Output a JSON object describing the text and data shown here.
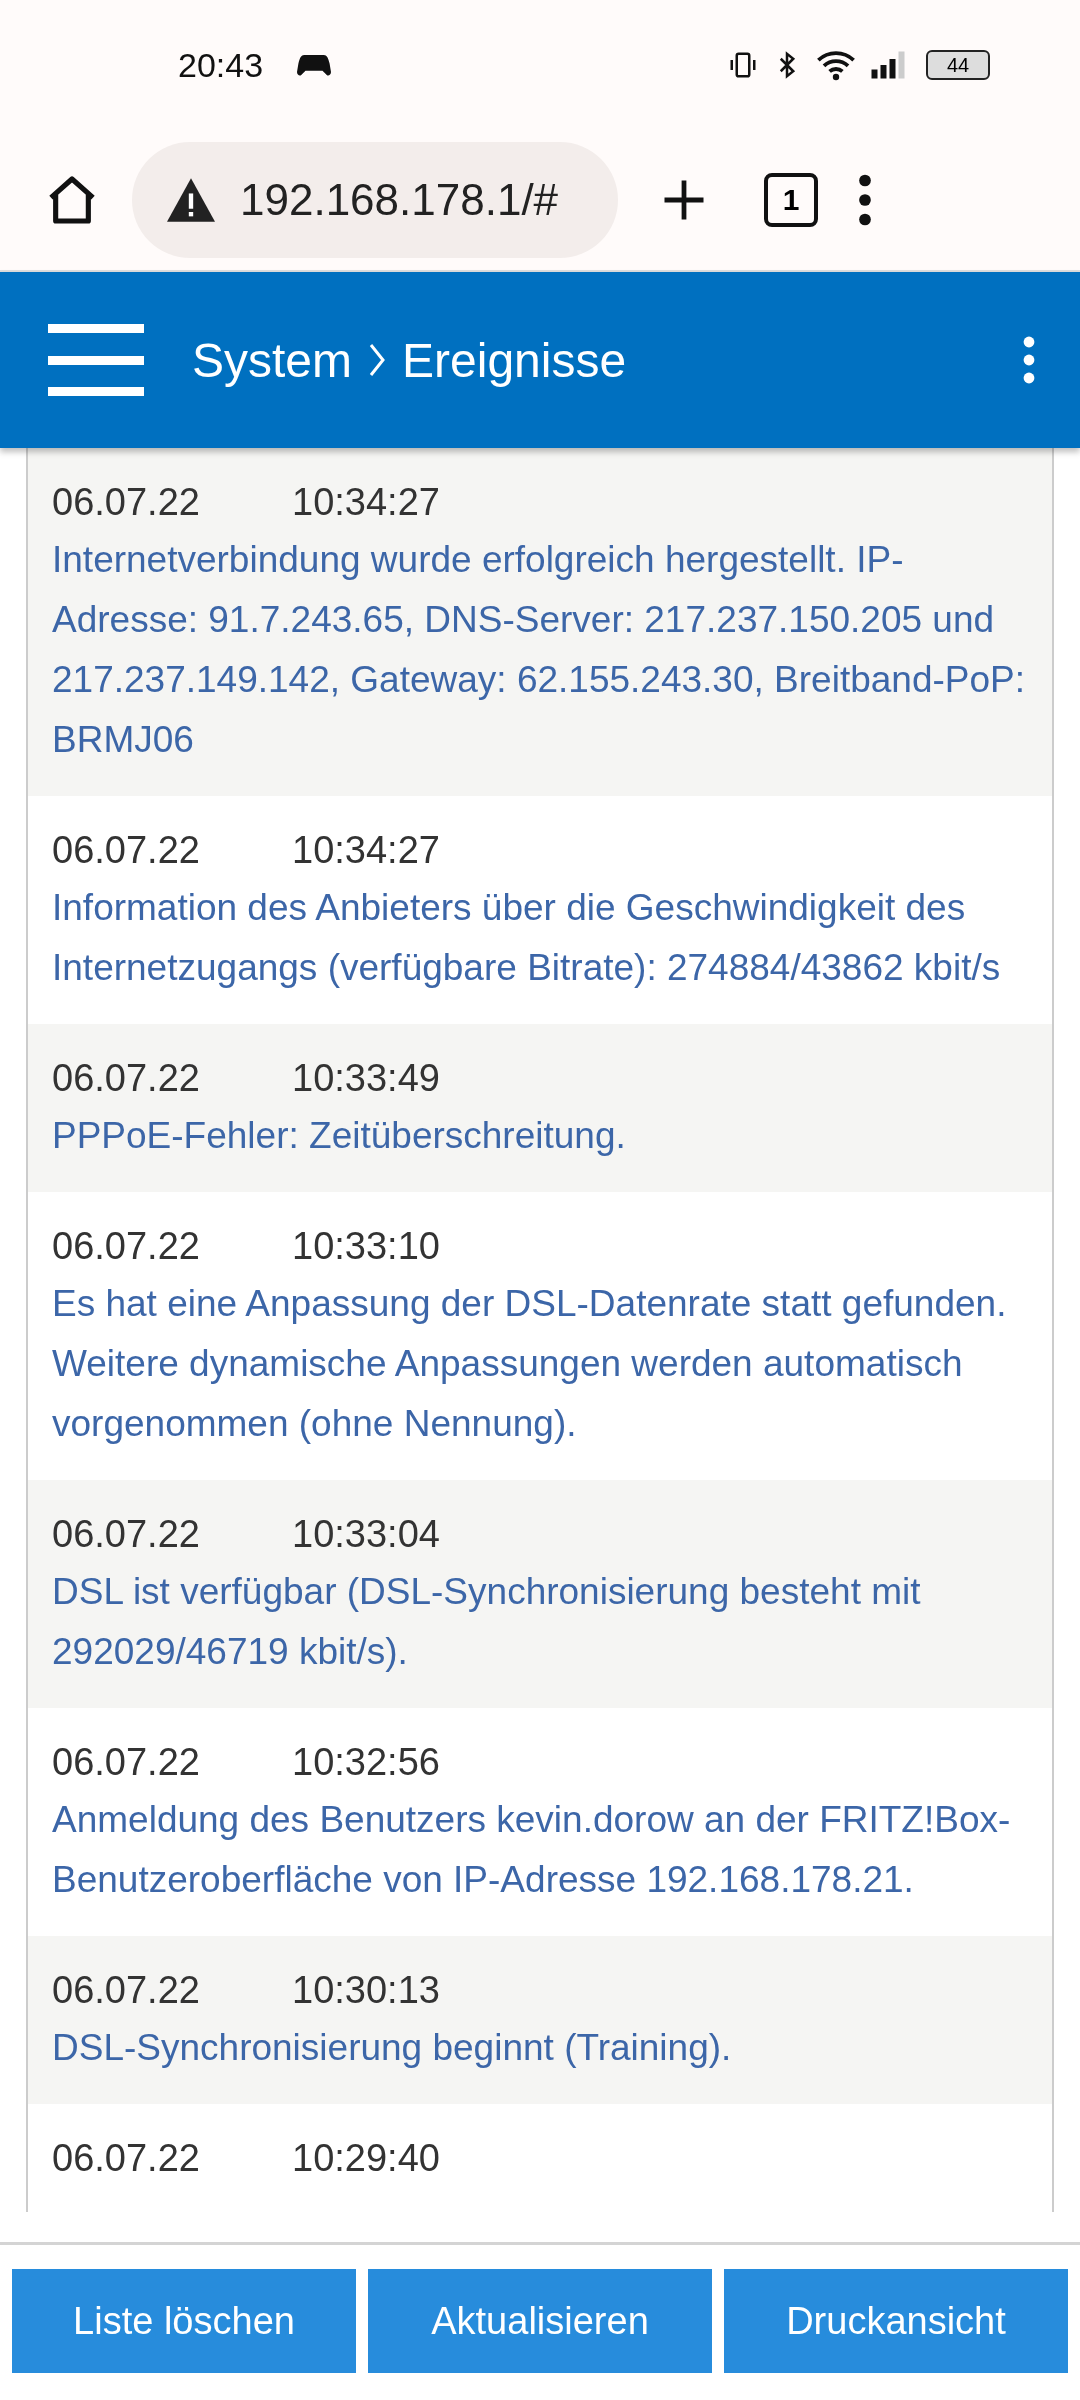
{
  "status_bar": {
    "time": "20:43",
    "battery": "44"
  },
  "browser": {
    "url": "192.168.178.1/#",
    "tab_count": "1"
  },
  "header": {
    "breadcrumb": [
      "System",
      "Ereignisse"
    ]
  },
  "events": [
    {
      "date": "06.07.22",
      "time": "10:34:27",
      "message": "Internetverbindung wurde erfolgreich hergestellt. IP-Adresse: 91.7.243.65, DNS-Server: 217.237.150.205 und 217.237.149.142, Gateway: 62.155.243.30, Breitband-PoP: BRMJ06"
    },
    {
      "date": "06.07.22",
      "time": "10:34:27",
      "message": "Information des Anbieters über die Geschwindigkeit des Internetzugangs (verfügbare Bitrate): 274884/43862 kbit/s"
    },
    {
      "date": "06.07.22",
      "time": "10:33:49",
      "message": "PPPoE-Fehler: Zeitüberschreitung."
    },
    {
      "date": "06.07.22",
      "time": "10:33:10",
      "message": "Es hat eine Anpassung der DSL-Datenrate statt gefunden. Weitere dynamische Anpassungen werden automatisch vorgenommen (ohne Nennung)."
    },
    {
      "date": "06.07.22",
      "time": "10:33:04",
      "message": "DSL ist verfügbar (DSL-Synchronisierung besteht mit 292029/46719 kbit/s)."
    },
    {
      "date": "06.07.22",
      "time": "10:32:56",
      "message": "Anmeldung des Benutzers kevin.dorow an der FRITZ!Box-Benutzeroberfläche von IP-Adresse 192.168.178.21."
    },
    {
      "date": "06.07.22",
      "time": "10:30:13",
      "message": "DSL-Synchronisierung beginnt (Training)."
    },
    {
      "date": "06.07.22",
      "time": "10:29:40"
    }
  ],
  "buttons": [
    "Liste löschen",
    "Aktualisieren",
    "Druckansicht"
  ]
}
